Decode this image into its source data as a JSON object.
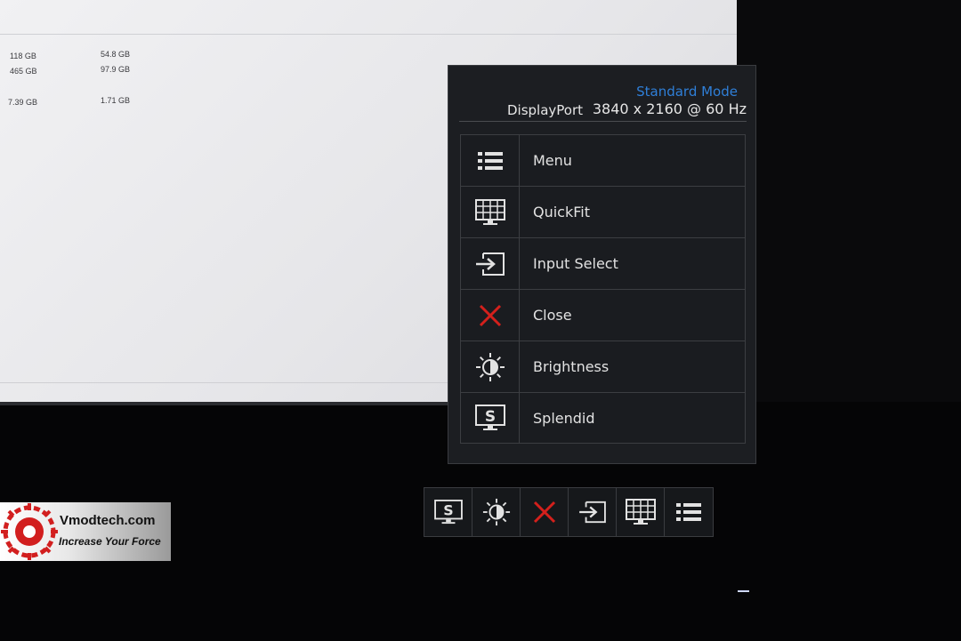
{
  "desktop": {
    "disks": [
      {
        "total": "118 GB",
        "free": "54.8 GB"
      },
      {
        "total": "465 GB",
        "free": "97.9 GB"
      },
      {
        "total": "7.39 GB",
        "free": "1.71 GB"
      }
    ]
  },
  "osd": {
    "mode": "Standard Mode",
    "source": "DisplayPort",
    "resolution": "3840 x 2160 @ 60 Hz",
    "items": [
      {
        "label": "Menu",
        "icon": "menu-list-icon"
      },
      {
        "label": "QuickFit",
        "icon": "quickfit-grid-icon"
      },
      {
        "label": "Input Select",
        "icon": "input-select-icon"
      },
      {
        "label": "Close",
        "icon": "close-icon"
      },
      {
        "label": "Brightness",
        "icon": "brightness-icon"
      },
      {
        "label": "Splendid",
        "icon": "splendid-icon"
      }
    ]
  },
  "hotkeys": [
    "splendid-icon",
    "brightness-icon",
    "close-icon",
    "input-select-icon",
    "quickfit-grid-icon",
    "menu-list-icon"
  ],
  "colors": {
    "accent": "#2f7fd8",
    "close": "#d4201c",
    "text": "#e2e2e2"
  },
  "logo": {
    "brand": "Vmodtech.com",
    "tagline": "Increase Your Force"
  }
}
